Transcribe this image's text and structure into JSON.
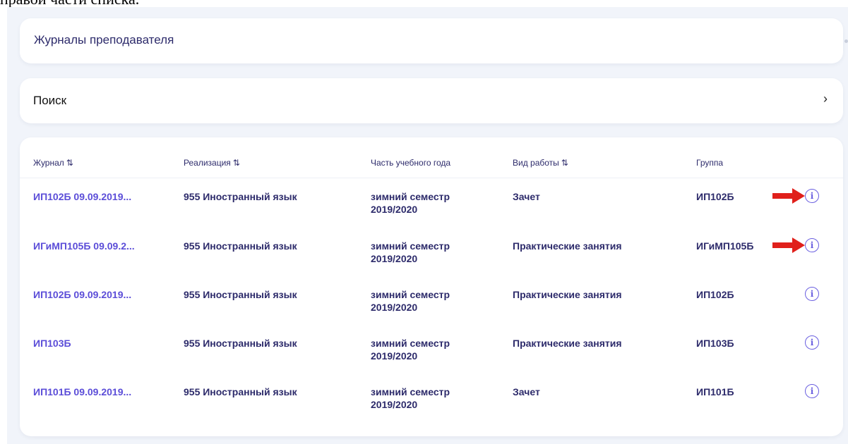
{
  "doc_fragment": "правой части списка.",
  "header": {
    "title": "Журналы преподавателя"
  },
  "search": {
    "label": "Поиск",
    "chevron": "›"
  },
  "table": {
    "columns": [
      {
        "label": "Журнал",
        "sortable": true
      },
      {
        "label": "Реализация",
        "sortable": true
      },
      {
        "label": "Часть учебного года",
        "sortable": false
      },
      {
        "label": "Вид работы",
        "sortable": true
      },
      {
        "label": "Группа",
        "sortable": false
      }
    ],
    "sort_icon": "⇅",
    "rows": [
      {
        "journal": "ИП102Б 09.09.2019...",
        "realization": "955 Иностранный язык",
        "term_line1": "зимний семестр",
        "term_line2": "2019/2020",
        "work_type": "Зачет",
        "group": "ИП102Б",
        "arrow": true
      },
      {
        "journal": "ИГиМП105Б 09.09.2...",
        "realization": "955 Иностранный язык",
        "term_line1": "зимний семестр",
        "term_line2": "2019/2020",
        "work_type": "Практические занятия",
        "group": "ИГиМП105Б",
        "arrow": true
      },
      {
        "journal": "ИП102Б 09.09.2019...",
        "realization": "955 Иностранный язык",
        "term_line1": "зимний семестр",
        "term_line2": "2019/2020",
        "work_type": "Практические занятия",
        "group": "ИП102Б",
        "arrow": false
      },
      {
        "journal": "ИП103Б",
        "realization": "955 Иностранный язык",
        "term_line1": "зимний семестр",
        "term_line2": "2019/2020",
        "work_type": "Практические занятия",
        "group": "ИП103Б",
        "arrow": false
      },
      {
        "journal": "ИП101Б 09.09.2019...",
        "realization": "955 Иностранный язык",
        "term_line1": "зимний семестр",
        "term_line2": "2019/2020",
        "work_type": "Зачет",
        "group": "ИП101Б",
        "arrow": false
      }
    ],
    "info_icon_glyph": "i"
  },
  "colors": {
    "accent": "#5b4dd8",
    "text_dark": "#2d2b6b",
    "arrow_red": "#e0201b",
    "background": "#f1f4fa"
  }
}
